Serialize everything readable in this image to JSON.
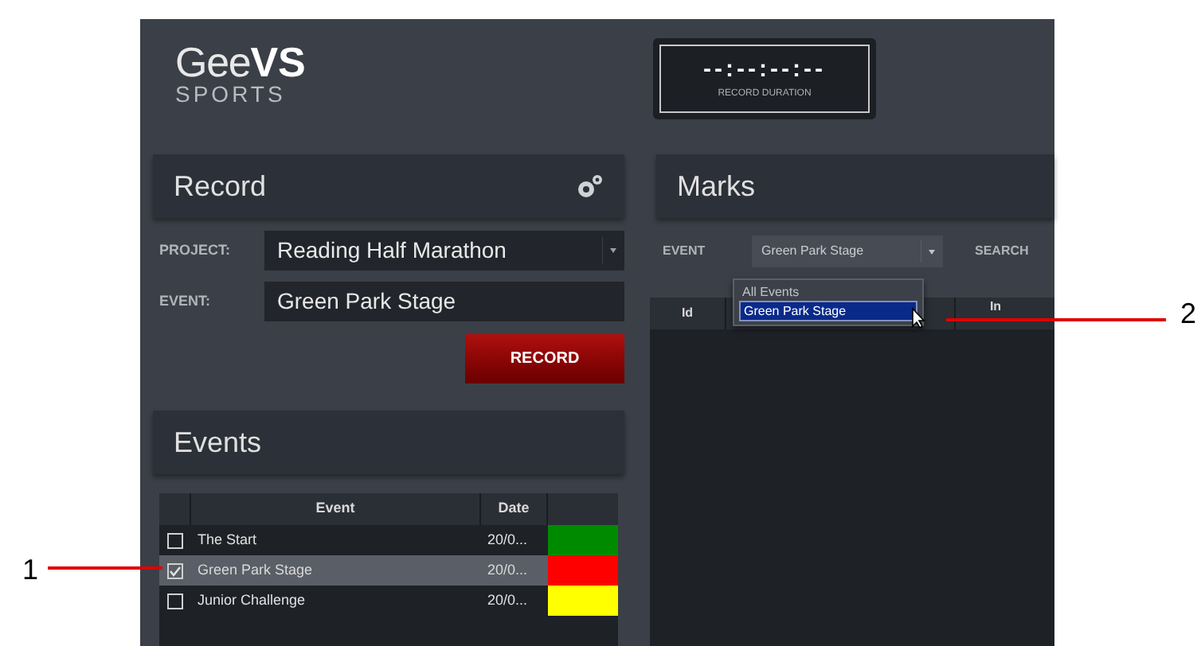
{
  "logo": {
    "light": "Gee",
    "bold": "VS",
    "sub": "SPORTS"
  },
  "timer": {
    "value": "--:--:--:--",
    "label": "RECORD DURATION"
  },
  "record_panel": {
    "title": "Record",
    "project_label": "PROJECT:",
    "project_value": "Reading Half Marathon",
    "event_label": "EVENT:",
    "event_value": "Green Park Stage",
    "button": "RECORD"
  },
  "events_panel": {
    "title": "Events",
    "columns": [
      "Event",
      "Date"
    ],
    "rows": [
      {
        "checked": false,
        "selected": false,
        "event": "The Start",
        "date": "20/0...",
        "color": "#008a00"
      },
      {
        "checked": true,
        "selected": true,
        "event": "Green Park Stage",
        "date": "20/0...",
        "color": "#ff0000"
      },
      {
        "checked": false,
        "selected": false,
        "event": "Junior Challenge",
        "date": "20/0...",
        "color": "#ffff00"
      }
    ]
  },
  "marks_panel": {
    "title": "Marks",
    "event_label": "EVENT",
    "event_value": "Green Park Stage",
    "search_label": "SEARCH",
    "dropdown_options": [
      {
        "label": "All Events",
        "selected": false
      },
      {
        "label": "Green Park Stage",
        "selected": true
      }
    ],
    "columns": [
      "Id",
      "In"
    ]
  },
  "callouts": [
    "1",
    "2"
  ]
}
